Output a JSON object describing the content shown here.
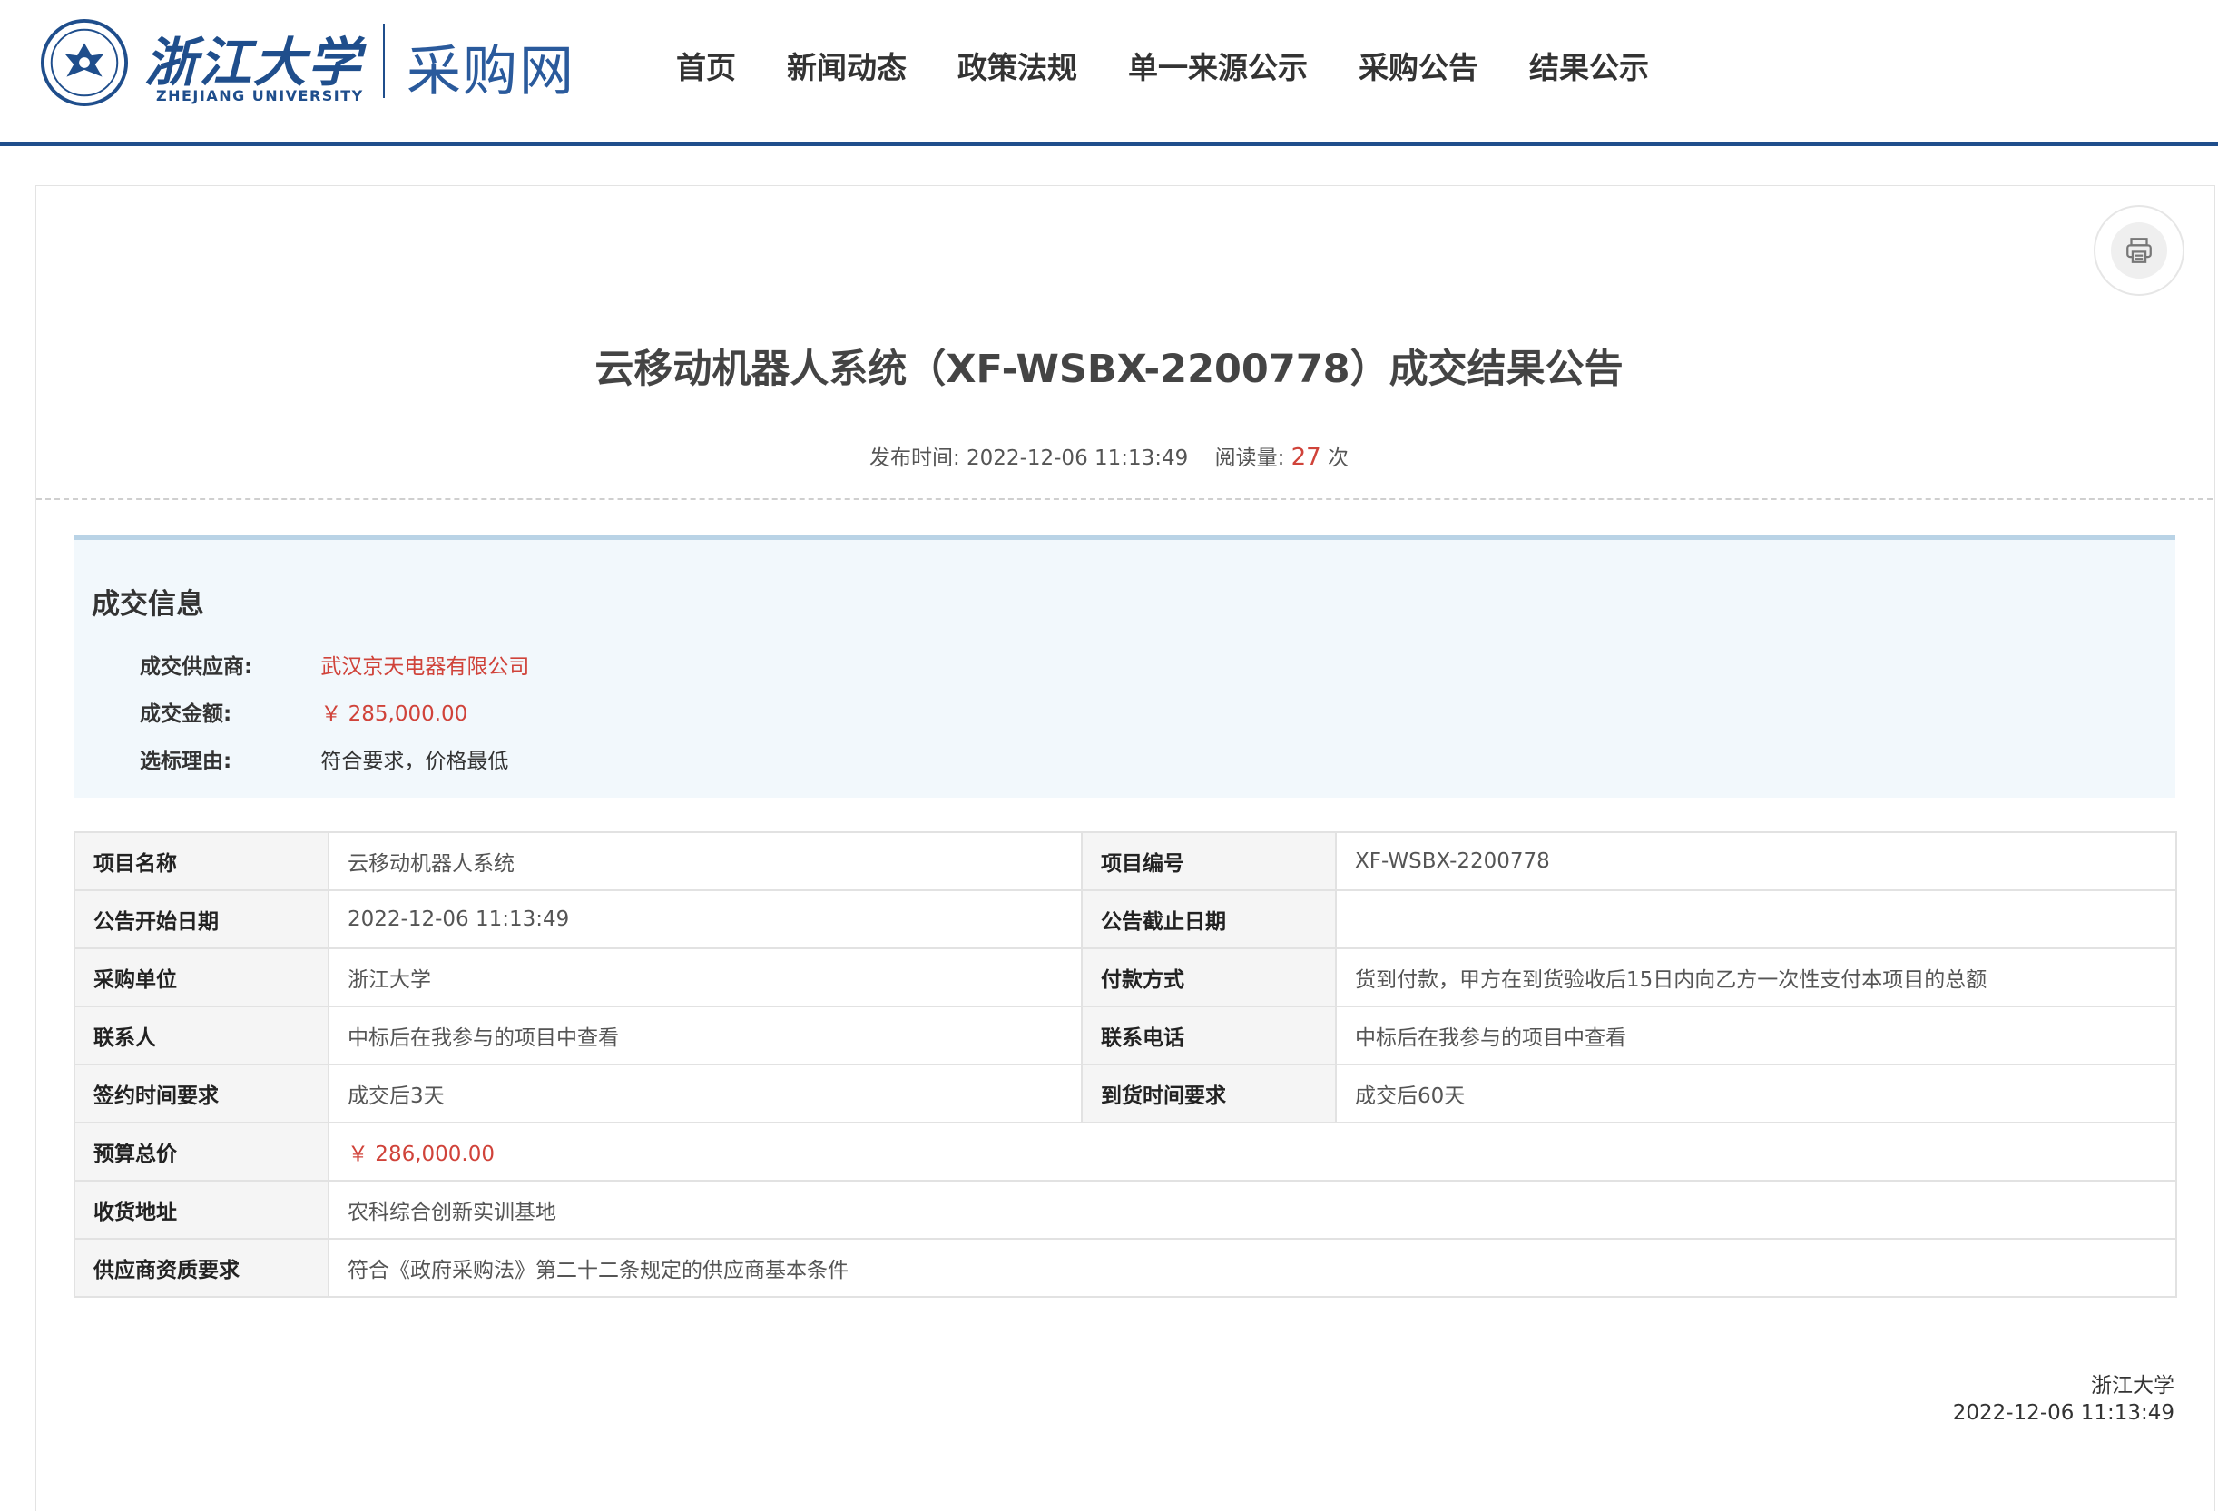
{
  "header": {
    "logo_cn": "浙江大学",
    "logo_en": "ZHEJIANG UNIVERSITY",
    "site_name": "采购网",
    "brand_color": "#1f4e8c",
    "nav": [
      {
        "label": "首页"
      },
      {
        "label": "新闻动态"
      },
      {
        "label": "政策法规"
      },
      {
        "label": "单一来源公示"
      },
      {
        "label": "采购公告"
      },
      {
        "label": "结果公示"
      }
    ]
  },
  "article": {
    "title": "云移动机器人系统（XF-WSBX-2200778）成交结果公告",
    "publish_label": "发布时间:",
    "publish_time": "2022-12-06 11:13:49",
    "read_label": "阅读量:",
    "read_count": "27",
    "read_unit": "次",
    "print_icon": "printer-icon"
  },
  "deal_info": {
    "title": "成交信息",
    "supplier_label": "成交供应商:",
    "supplier": "武汉京天电器有限公司",
    "amount_label": "成交金额:",
    "amount": "￥ 285,000.00",
    "reason_label": "选标理由:",
    "reason": "符合要求，价格最低",
    "highlight_color": "#d0433a"
  },
  "details": {
    "project_name_label": "项目名称",
    "project_name": "云移动机器人系统",
    "project_no_label": "项目编号",
    "project_no": "XF-WSBX-2200778",
    "start_date_label": "公告开始日期",
    "start_date": "2022-12-06 11:13:49",
    "end_date_label": "公告截止日期",
    "end_date": "",
    "buyer_label": "采购单位",
    "buyer": "浙江大学",
    "payment_label": "付款方式",
    "payment": "货到付款，甲方在到货验收后15日内向乙方一次性支付本项目的总额",
    "contact_label": "联系人",
    "contact": "中标后在我参与的项目中查看",
    "phone_label": "联系电话",
    "phone": "中标后在我参与的项目中查看",
    "sign_time_label": "签约时间要求",
    "sign_time": "成交后3天",
    "delivery_time_label": "到货时间要求",
    "delivery_time": "成交后60天",
    "budget_label": "预算总价",
    "budget": "￥ 286,000.00",
    "address_label": "收货地址",
    "address": "农科综合创新实训基地",
    "qualification_label": "供应商资质要求",
    "qualification": "符合《政府采购法》第二十二条规定的供应商基本条件"
  },
  "footer": {
    "org": "浙江大学",
    "date": "2022-12-06 11:13:49"
  }
}
